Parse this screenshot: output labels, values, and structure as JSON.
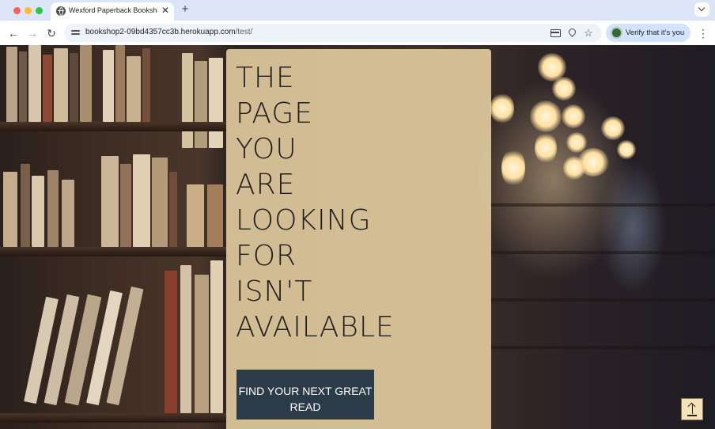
{
  "browser": {
    "tab_title": "Wexford Paperback Bookshop",
    "tab_close": "✕",
    "new_tab": "+",
    "url_host": "bookshop2-09bd4357cc3b.herokuapp.com",
    "url_path": "/test/",
    "verify_label": "Verify that it's you",
    "icons": [
      "globe-icon",
      "tune-icon",
      "card-icon",
      "location-pin-icon",
      "bookmark-star-icon",
      "kebab-menu-icon"
    ]
  },
  "page": {
    "headline_lines": [
      "THE",
      "PAGE",
      "YOU",
      "ARE",
      "LOOKING",
      "FOR",
      "ISN'T",
      "AVAILABLE"
    ],
    "cta_label": "FIND YOUR NEXT GREAT READ",
    "back_to_top_icon": "arrow-up-to-line-icon"
  },
  "colors": {
    "panel": "#ffe7b4",
    "cta_background": "#2c3b4a",
    "cta_text": "#ffffff",
    "tabstrip": "#dbe5f7"
  }
}
